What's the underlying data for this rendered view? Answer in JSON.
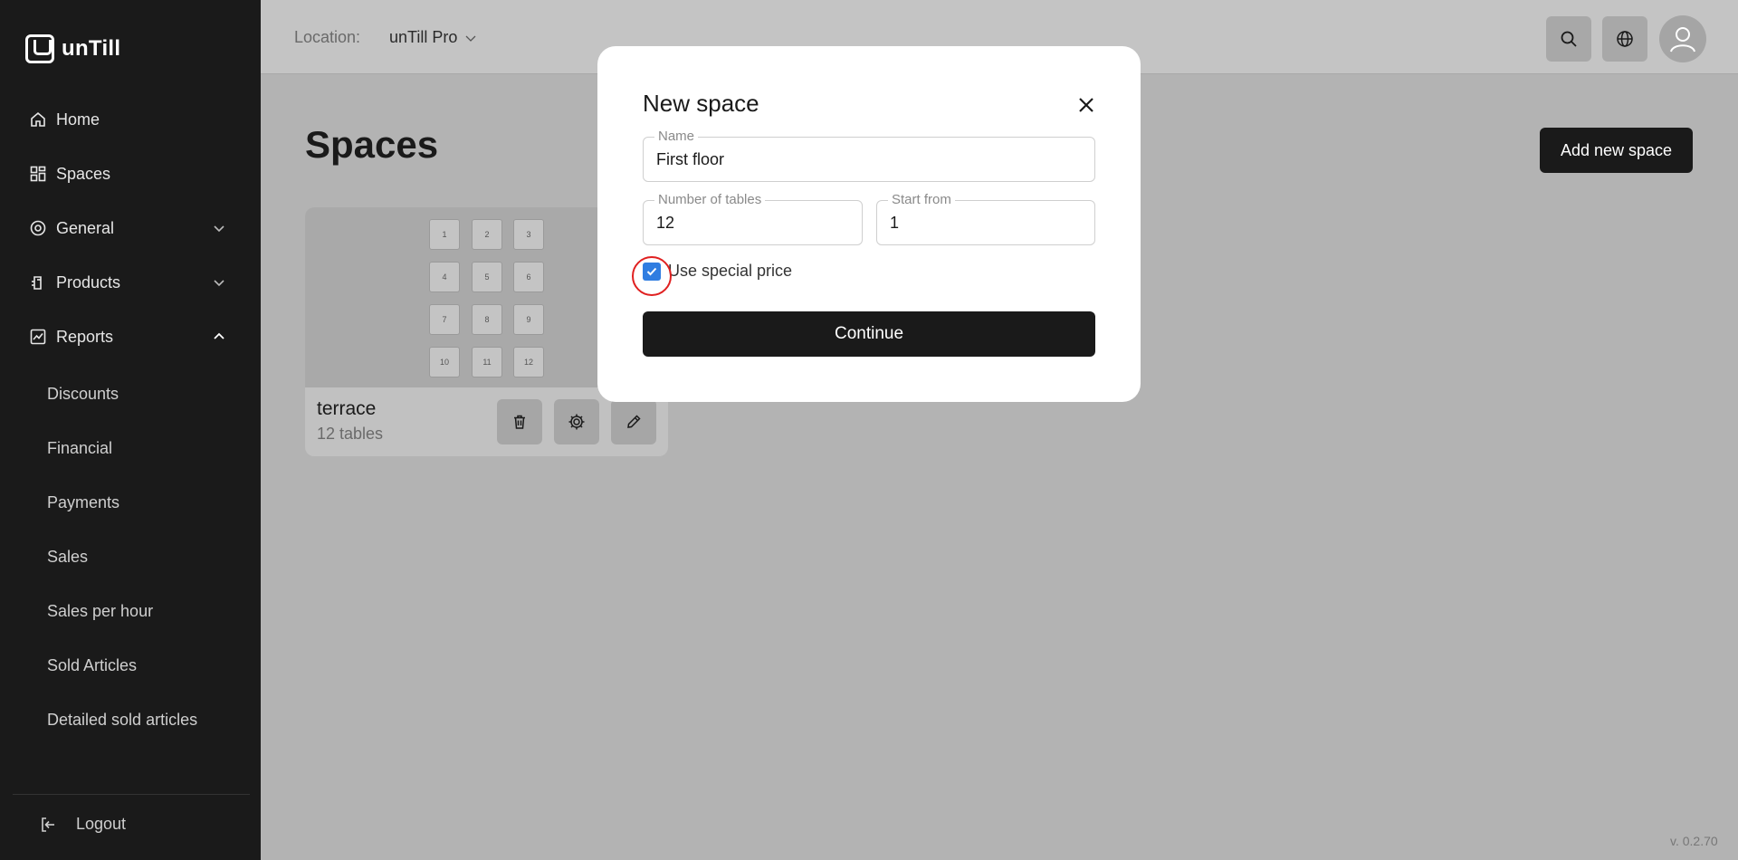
{
  "app": {
    "brand": "unTill",
    "version": "v. 0.2.70"
  },
  "sidebar": {
    "items": [
      {
        "label": "Home",
        "icon": "home-icon"
      },
      {
        "label": "Spaces",
        "icon": "grid-icon"
      },
      {
        "label": "General",
        "icon": "settings-circle-icon"
      },
      {
        "label": "Products",
        "icon": "products-icon"
      },
      {
        "label": "Reports",
        "icon": "chart-icon"
      }
    ],
    "report_items": [
      "Discounts",
      "Financial",
      "Payments",
      "Sales",
      "Sales per hour",
      "Sold Articles",
      "Detailed sold articles"
    ],
    "logout_label": "Logout"
  },
  "topbar": {
    "location_label": "Location:",
    "location_value": "unTill Pro"
  },
  "main": {
    "title": "Spaces",
    "add_button": "Add new space",
    "spaces": [
      {
        "name": "terrace",
        "subtitle": "12 tables",
        "tables": [
          "1",
          "2",
          "3",
          "4",
          "5",
          "6",
          "7",
          "8",
          "9",
          "10",
          "11",
          "12"
        ]
      }
    ]
  },
  "modal": {
    "title": "New space",
    "name_label": "Name",
    "name_value": "First floor",
    "tables_label": "Number of tables",
    "tables_value": "12",
    "start_label": "Start from",
    "start_value": "1",
    "special_price_label": "Use special price",
    "special_price_checked": true,
    "continue_label": "Continue"
  },
  "colors": {
    "sidebar_bg": "#1a1a1a",
    "overlay_bg": "#b3b3b3",
    "checkbox_accent": "#2f7de1",
    "highlight_ring": "#e02020"
  }
}
